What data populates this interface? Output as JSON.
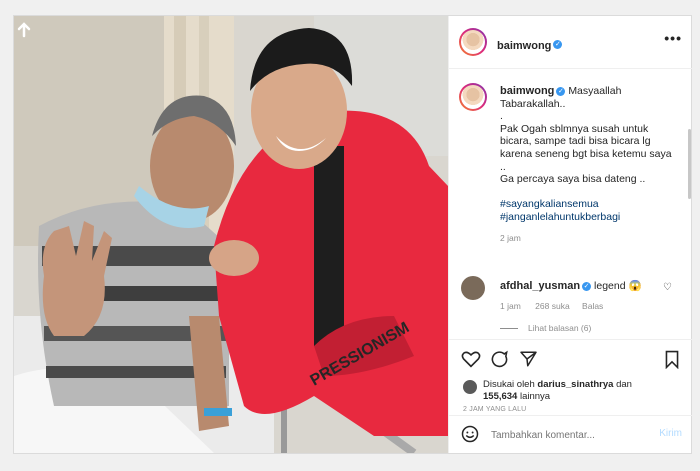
{
  "post": {
    "username": "baimwong",
    "more_icon": "more-horizontal-icon"
  },
  "caption": {
    "username": "baimwong",
    "lines": [
      "Masyaallah",
      "Tabarakallah..",
      ".",
      "Pak Ogah sblmnya susah untuk",
      "bicara, sampe tadi bisa bicara lg",
      "karena seneng bgt bisa ketemu saya",
      "..",
      "Ga percaya saya bisa dateng .."
    ],
    "hashtags": [
      "#sayangkaliansemua",
      "#janganlelahuntukberbagi"
    ],
    "time": "2 jam"
  },
  "comment": {
    "username": "afdhal_yusman",
    "text": "legend",
    "emoji": "😱",
    "time": "1 jam",
    "likes": "268 suka",
    "reply": "Balas",
    "view_replies": "Lihat balasan (6)"
  },
  "likes": {
    "prefix": "Disukai oleh",
    "user": "darius_sinathrya",
    "joiner": "dan",
    "count": "155,634",
    "suffix": "lainnya"
  },
  "timestamp": "2 JAM YANG LALU",
  "add_comment": {
    "placeholder": "Tambahkan komentar...",
    "post_label": "Kirim"
  },
  "colors": {
    "accent": "#3897f0",
    "hashtag": "#00376b",
    "muted": "#8e8e8e",
    "hoodie": "#e8293f"
  }
}
